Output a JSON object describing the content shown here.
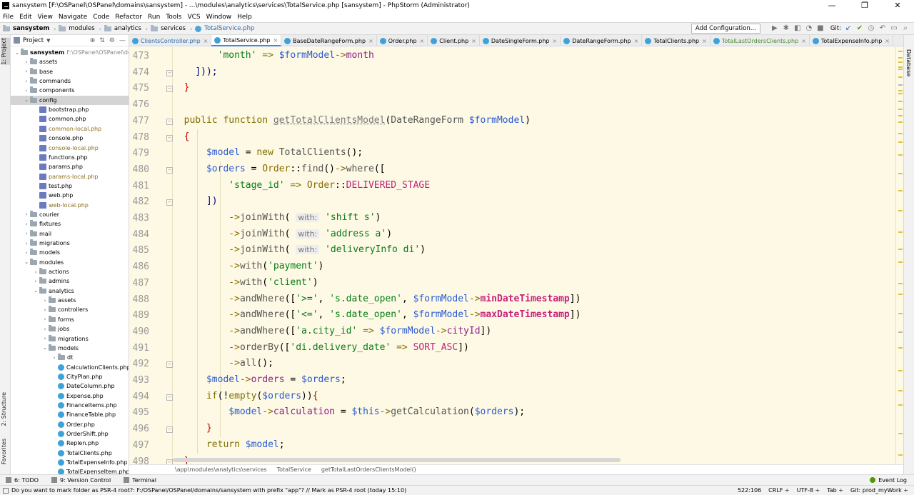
{
  "window": {
    "title": "sansystem [F:\\OSPanel\\OSPanel\\domains\\sansystem] - ...\\modules\\analytics\\services\\TotalService.php [sansystem] - PhpStorm (Administrator)",
    "min": "—",
    "max": "❐",
    "close": "✕"
  },
  "menu": [
    "File",
    "Edit",
    "View",
    "Navigate",
    "Code",
    "Refactor",
    "Run",
    "Tools",
    "VCS",
    "Window",
    "Help"
  ],
  "navbar": {
    "crumbs": [
      "sansystem",
      "modules",
      "analytics",
      "services"
    ],
    "file": "TotalService.php",
    "add_config": "Add Configuration...",
    "git": "Git:"
  },
  "left_stripe": {
    "project": "1: Project",
    "structure": "2: Structure",
    "favorites": "Favorites"
  },
  "right_stripe": {
    "database": "Database"
  },
  "project": {
    "header": "Project",
    "root_name": "sansystem",
    "root_path": "F:\\OSPanel\\OSPanel\\domains\\sansystem",
    "items": [
      {
        "label": "assets",
        "kind": "dir",
        "depth": 1,
        "arrow": "›"
      },
      {
        "label": "base",
        "kind": "dir",
        "depth": 1,
        "arrow": "›"
      },
      {
        "label": "commands",
        "kind": "dir",
        "depth": 1,
        "arrow": "›"
      },
      {
        "label": "components",
        "kind": "dir",
        "depth": 1,
        "arrow": "›"
      },
      {
        "label": "config",
        "kind": "dir",
        "depth": 1,
        "arrow": "⌄",
        "selected": true
      },
      {
        "label": "bootstrap.php",
        "kind": "php",
        "depth": 2
      },
      {
        "label": "common.php",
        "kind": "php",
        "depth": 2
      },
      {
        "label": "common-local.php",
        "kind": "php",
        "depth": 2,
        "local": true
      },
      {
        "label": "console.php",
        "kind": "php",
        "depth": 2
      },
      {
        "label": "console-local.php",
        "kind": "php",
        "depth": 2,
        "local": true
      },
      {
        "label": "functions.php",
        "kind": "php",
        "depth": 2
      },
      {
        "label": "params.php",
        "kind": "php",
        "depth": 2
      },
      {
        "label": "params-local.php",
        "kind": "php",
        "depth": 2,
        "local": true
      },
      {
        "label": "test.php",
        "kind": "php",
        "depth": 2
      },
      {
        "label": "web.php",
        "kind": "php",
        "depth": 2
      },
      {
        "label": "web-local.php",
        "kind": "php",
        "depth": 2,
        "local": true
      },
      {
        "label": "courier",
        "kind": "dir",
        "depth": 1,
        "arrow": "›"
      },
      {
        "label": "fixtures",
        "kind": "dir",
        "depth": 1,
        "arrow": "›"
      },
      {
        "label": "mail",
        "kind": "dir",
        "depth": 1,
        "arrow": "›"
      },
      {
        "label": "migrations",
        "kind": "dir",
        "depth": 1,
        "arrow": "›"
      },
      {
        "label": "models",
        "kind": "dir",
        "depth": 1,
        "arrow": "›"
      },
      {
        "label": "modules",
        "kind": "dir",
        "depth": 1,
        "arrow": "⌄"
      },
      {
        "label": "actions",
        "kind": "dir",
        "depth": 2,
        "arrow": "›"
      },
      {
        "label": "admins",
        "kind": "dir",
        "depth": 2,
        "arrow": "›"
      },
      {
        "label": "analytics",
        "kind": "dir",
        "depth": 2,
        "arrow": "⌄"
      },
      {
        "label": "assets",
        "kind": "dir",
        "depth": 3,
        "arrow": "›"
      },
      {
        "label": "controllers",
        "kind": "dir",
        "depth": 3,
        "arrow": "›"
      },
      {
        "label": "forms",
        "kind": "dir",
        "depth": 3,
        "arrow": "›"
      },
      {
        "label": "jobs",
        "kind": "dir",
        "depth": 3,
        "arrow": "›"
      },
      {
        "label": "migrations",
        "kind": "dir",
        "depth": 3,
        "arrow": "›"
      },
      {
        "label": "models",
        "kind": "dir",
        "depth": 3,
        "arrow": "⌄"
      },
      {
        "label": "dt",
        "kind": "dir",
        "depth": 4,
        "arrow": "›"
      },
      {
        "label": "CalculationClients.php",
        "kind": "cls",
        "depth": 4
      },
      {
        "label": "CityPlan.php",
        "kind": "cls",
        "depth": 4
      },
      {
        "label": "DateColumn.php",
        "kind": "cls",
        "depth": 4
      },
      {
        "label": "Expense.php",
        "kind": "cls",
        "depth": 4
      },
      {
        "label": "FinanceItems.php",
        "kind": "cls",
        "depth": 4
      },
      {
        "label": "FinanceTable.php",
        "kind": "cls",
        "depth": 4
      },
      {
        "label": "Order.php",
        "kind": "cls",
        "depth": 4
      },
      {
        "label": "OrderShift.php",
        "kind": "cls",
        "depth": 4
      },
      {
        "label": "Replen.php",
        "kind": "cls",
        "depth": 4
      },
      {
        "label": "TotalClients.php",
        "kind": "cls",
        "depth": 4
      },
      {
        "label": "TotalExpenseInfo.php",
        "kind": "cls",
        "depth": 4
      },
      {
        "label": "TotalExpenseItem.php",
        "kind": "cls",
        "depth": 4
      }
    ]
  },
  "tabs": [
    {
      "label": "ClientsController.php",
      "color": "blue"
    },
    {
      "label": "TotalService.php",
      "active": true
    },
    {
      "label": "BaseDateRangeForm.php"
    },
    {
      "label": "Order.php"
    },
    {
      "label": "Client.php"
    },
    {
      "label": "DateSingleForm.php"
    },
    {
      "label": "DateRangeForm.php"
    },
    {
      "label": "TotalClients.php"
    },
    {
      "label": "TotalLastOrdersClients.php",
      "color": "green"
    },
    {
      "label": "TotalExpenseInfo.php"
    }
  ],
  "editor": {
    "line_numbers": [
      "473",
      "474",
      "475",
      "476",
      "477",
      "478",
      "479",
      "480",
      "481",
      "482",
      "483",
      "484",
      "485",
      "486",
      "487",
      "488",
      "489",
      "490",
      "491",
      "492",
      "493",
      "494",
      "495",
      "496",
      "497",
      "498"
    ],
    "lines": [
      [
        {
          "t": "        "
        },
        {
          "c": "str",
          "t": "'month'"
        },
        {
          "t": " "
        },
        {
          "c": "kw",
          "t": "=>"
        },
        {
          "t": " "
        },
        {
          "c": "var",
          "t": "$formModel"
        },
        {
          "c": "arrow-op",
          "t": "->"
        },
        {
          "c": "prop",
          "t": "month"
        }
      ],
      [
        {
          "t": "    "
        },
        {
          "c": "kw2",
          "t": "]));"
        }
      ],
      [
        {
          "t": "  "
        },
        {
          "c": "brace",
          "t": "}"
        }
      ],
      [
        {
          "t": ""
        }
      ],
      [
        {
          "t": "  "
        },
        {
          "c": "kw",
          "t": "public function "
        },
        {
          "c": "fn-decl",
          "t": "getTotalClientsModel"
        },
        {
          "t": "("
        },
        {
          "c": "fn",
          "t": "DateRangeForm "
        },
        {
          "c": "var",
          "t": "$formModel"
        },
        {
          "t": ")"
        }
      ],
      [
        {
          "t": "  "
        },
        {
          "c": "brace",
          "t": "{"
        }
      ],
      [
        {
          "t": "      "
        },
        {
          "c": "var",
          "t": "$model"
        },
        {
          "t": " = "
        },
        {
          "c": "kw",
          "t": "new "
        },
        {
          "c": "fn",
          "t": "TotalClients"
        },
        {
          "t": "();"
        }
      ],
      [
        {
          "t": "      "
        },
        {
          "c": "var",
          "t": "$orders"
        },
        {
          "t": " = "
        },
        {
          "c": "cls",
          "t": "Order"
        },
        {
          "t": "::"
        },
        {
          "c": "fn",
          "t": "find"
        },
        {
          "t": "()"
        },
        {
          "c": "arrow-op",
          "t": "->"
        },
        {
          "c": "fn",
          "t": "where"
        },
        {
          "t": "(["
        }
      ],
      [
        {
          "t": "          "
        },
        {
          "c": "str",
          "t": "'stage_id'"
        },
        {
          "t": " "
        },
        {
          "c": "kw",
          "t": "=>"
        },
        {
          "t": " "
        },
        {
          "c": "cls",
          "t": "Order"
        },
        {
          "t": "::"
        },
        {
          "c": "const",
          "t": "DELIVERED_STAGE"
        }
      ],
      [
        {
          "t": "      "
        },
        {
          "c": "kw2",
          "t": "])"
        }
      ],
      [
        {
          "t": "          "
        },
        {
          "c": "arrow-op",
          "t": "->"
        },
        {
          "c": "fn",
          "t": "joinWith"
        },
        {
          "t": "( "
        },
        {
          "c": "hint",
          "t": "with:"
        },
        {
          "t": " "
        },
        {
          "c": "str",
          "t": "'shift s'"
        },
        {
          "t": ")"
        }
      ],
      [
        {
          "t": "          "
        },
        {
          "c": "arrow-op",
          "t": "->"
        },
        {
          "c": "fn",
          "t": "joinWith"
        },
        {
          "t": "( "
        },
        {
          "c": "hint",
          "t": "with:"
        },
        {
          "t": " "
        },
        {
          "c": "str",
          "t": "'address a'"
        },
        {
          "t": ")"
        }
      ],
      [
        {
          "t": "          "
        },
        {
          "c": "arrow-op",
          "t": "->"
        },
        {
          "c": "fn",
          "t": "joinWith"
        },
        {
          "t": "( "
        },
        {
          "c": "hint",
          "t": "with:"
        },
        {
          "t": " "
        },
        {
          "c": "str",
          "t": "'deliveryInfo di'"
        },
        {
          "t": ")"
        }
      ],
      [
        {
          "t": "          "
        },
        {
          "c": "arrow-op",
          "t": "->"
        },
        {
          "c": "fn",
          "t": "with"
        },
        {
          "t": "("
        },
        {
          "c": "str",
          "t": "'payment'"
        },
        {
          "t": ")"
        }
      ],
      [
        {
          "t": "          "
        },
        {
          "c": "arrow-op",
          "t": "->"
        },
        {
          "c": "fn",
          "t": "with"
        },
        {
          "t": "("
        },
        {
          "c": "str",
          "t": "'client'"
        },
        {
          "t": ")"
        }
      ],
      [
        {
          "t": "          "
        },
        {
          "c": "arrow-op",
          "t": "->"
        },
        {
          "c": "fn",
          "t": "andWhere"
        },
        {
          "t": "(["
        },
        {
          "c": "str",
          "t": "'>='"
        },
        {
          "t": ", "
        },
        {
          "c": "str",
          "t": "'s.date_open'"
        },
        {
          "t": ", "
        },
        {
          "c": "var",
          "t": "$formModel"
        },
        {
          "c": "arrow-op",
          "t": "->"
        },
        {
          "c": "prop-b",
          "t": "minDateTimestamp"
        },
        {
          "t": "])"
        }
      ],
      [
        {
          "t": "          "
        },
        {
          "c": "arrow-op",
          "t": "->"
        },
        {
          "c": "fn",
          "t": "andWhere"
        },
        {
          "t": "(["
        },
        {
          "c": "str",
          "t": "'<='"
        },
        {
          "t": ", "
        },
        {
          "c": "str",
          "t": "'s.date_open'"
        },
        {
          "t": ", "
        },
        {
          "c": "var",
          "t": "$formModel"
        },
        {
          "c": "arrow-op",
          "t": "->"
        },
        {
          "c": "prop-b",
          "t": "maxDateTimestamp"
        },
        {
          "t": "])"
        }
      ],
      [
        {
          "t": "          "
        },
        {
          "c": "arrow-op",
          "t": "->"
        },
        {
          "c": "fn",
          "t": "andWhere"
        },
        {
          "t": "(["
        },
        {
          "c": "str",
          "t": "'a.city_id'"
        },
        {
          "t": " "
        },
        {
          "c": "kw",
          "t": "=>"
        },
        {
          "t": " "
        },
        {
          "c": "var",
          "t": "$formModel"
        },
        {
          "c": "arrow-op",
          "t": "->"
        },
        {
          "c": "prop",
          "t": "cityId"
        },
        {
          "t": "])"
        }
      ],
      [
        {
          "t": "          "
        },
        {
          "c": "arrow-op",
          "t": "->"
        },
        {
          "c": "fn",
          "t": "orderBy"
        },
        {
          "t": "(["
        },
        {
          "c": "str",
          "t": "'di.delivery_date'"
        },
        {
          "t": " "
        },
        {
          "c": "kw",
          "t": "=>"
        },
        {
          "t": " "
        },
        {
          "c": "const",
          "t": "SORT_ASC"
        },
        {
          "t": "])"
        }
      ],
      [
        {
          "t": "          "
        },
        {
          "c": "arrow-op",
          "t": "->"
        },
        {
          "c": "fn",
          "t": "all"
        },
        {
          "t": "();"
        }
      ],
      [
        {
          "t": "      "
        },
        {
          "c": "var",
          "t": "$model"
        },
        {
          "c": "arrow-op",
          "t": "->"
        },
        {
          "c": "prop",
          "t": "orders"
        },
        {
          "t": " = "
        },
        {
          "c": "var",
          "t": "$orders"
        },
        {
          "t": ";"
        }
      ],
      [
        {
          "t": "      "
        },
        {
          "c": "kw",
          "t": "if"
        },
        {
          "t": "(!"
        },
        {
          "c": "kw",
          "t": "empty"
        },
        {
          "t": "("
        },
        {
          "c": "var",
          "t": "$orders"
        },
        {
          "t": "))"
        },
        {
          "c": "brace",
          "t": "{"
        }
      ],
      [
        {
          "t": "          "
        },
        {
          "c": "var",
          "t": "$model"
        },
        {
          "c": "arrow-op",
          "t": "->"
        },
        {
          "c": "prop",
          "t": "calculation"
        },
        {
          "t": " = "
        },
        {
          "c": "var",
          "t": "$this"
        },
        {
          "c": "arrow-op",
          "t": "->"
        },
        {
          "c": "fn",
          "t": "getCalculation"
        },
        {
          "t": "("
        },
        {
          "c": "var",
          "t": "$orders"
        },
        {
          "t": ");"
        }
      ],
      [
        {
          "t": "      "
        },
        {
          "c": "brace",
          "t": "}"
        }
      ],
      [
        {
          "t": "      "
        },
        {
          "c": "kw",
          "t": "return "
        },
        {
          "c": "var",
          "t": "$model"
        },
        {
          "t": ";"
        }
      ],
      [
        {
          "t": "  "
        },
        {
          "c": "brace",
          "t": "}"
        }
      ]
    ]
  },
  "editor_breadcrumb": [
    "\\app\\modules\\analytics\\services",
    "TotalService",
    "getTotalLastOrdersClientsModel()"
  ],
  "bottombar": {
    "todo": "6: TODO",
    "vcs": "9: Version Control",
    "terminal": "Terminal",
    "event_log": "Event Log"
  },
  "statusbar": {
    "message": "Do you want to mark folder as PSR-4 root?: F:/OSPanel/OSPanel/domains/sansystem with prefix \"app\"? // Mark as PSR-4 root (today 15:10)",
    "position": "522:106",
    "line_sep": "CRLF ÷",
    "encoding": "UTF-8 ÷",
    "indent": "Tab ÷",
    "branch": "Git: prod_myWork ÷"
  }
}
